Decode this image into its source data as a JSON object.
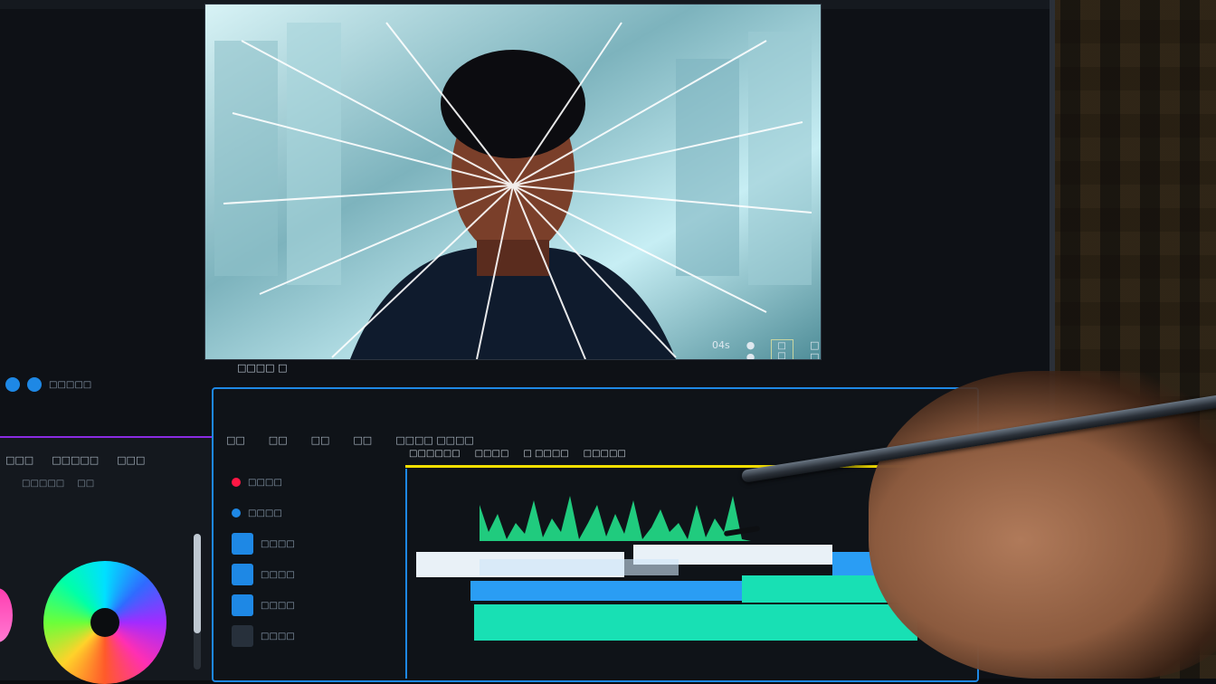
{
  "preview": {
    "controls": [
      "04s",
      "● ●"
    ],
    "badge": "□ □ □ □ ○",
    "status": "□ □ □ □ □"
  },
  "timecode": "□□□□ □",
  "left_under": {
    "label": "□□□□□"
  },
  "transport": {
    "buttons": [
      "→",
      "⟲",
      "⊂",
      "⊃",
      "⟳",
      "◻",
      "✕",
      "⊚",
      "◐"
    ]
  },
  "color_panel": {
    "head": [
      "□□□",
      "□□□□□",
      "□□□"
    ],
    "row": [
      "□□□□□",
      "□□"
    ]
  },
  "timeline": {
    "tabs": [
      "□□",
      "□□",
      "□□",
      "□□",
      "□□□□ □□□□"
    ],
    "markers": [
      "□□□□□□",
      "□□□□",
      "□ □□□□",
      "□□□□□"
    ],
    "tracks": [
      {
        "label": "□□□□",
        "rec_color": "#ff1744"
      },
      {
        "label": "□□□□",
        "rec_color": "#1e88e5"
      },
      {
        "label": "□□□□"
      },
      {
        "label": "□□□□"
      },
      {
        "label": "□□□□"
      },
      {
        "label": "□□□□"
      }
    ]
  },
  "colors": {
    "accent": "#1e88e5",
    "ruler": "#f5e000",
    "clip_teal": "#18e0b4",
    "clip_blue": "#2a9df4",
    "clip_white": "#e9f1f7",
    "waveform_green": "#22e08a"
  }
}
